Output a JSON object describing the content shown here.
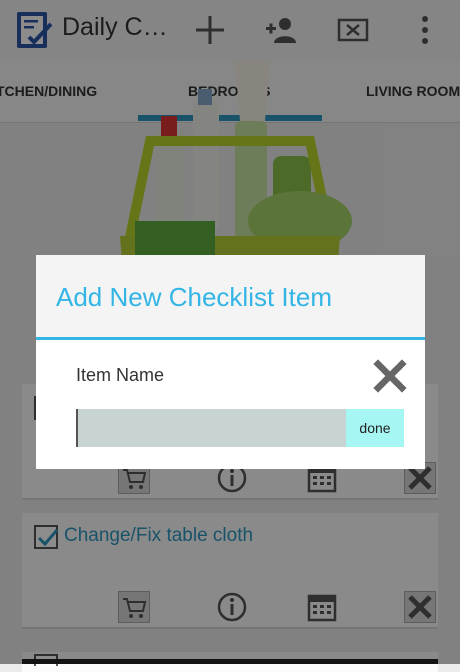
{
  "actionbar": {
    "title": "Daily C…",
    "icons": [
      "checklist-app-icon",
      "add-icon",
      "add-person-icon",
      "clear-box-icon",
      "overflow-menu-icon"
    ]
  },
  "tabs": [
    {
      "label": "TCHEN/DINING"
    },
    {
      "label": "BEDROOMS",
      "selected": true
    },
    {
      "label": "LIVING ROOM"
    }
  ],
  "cards": [
    {
      "title": "",
      "checked": true
    },
    {
      "title": "Change/Fix table cloth",
      "checked": true
    }
  ],
  "dialog": {
    "title": "Add New Checklist Item",
    "field_label": "Item Name",
    "input_value": "",
    "done_label": "done"
  },
  "colors": {
    "accent": "#33b5e5",
    "tab_indicator": "#2f97c1",
    "done_button": "#a6f6f4",
    "input_bg": "#c8d3d3"
  }
}
